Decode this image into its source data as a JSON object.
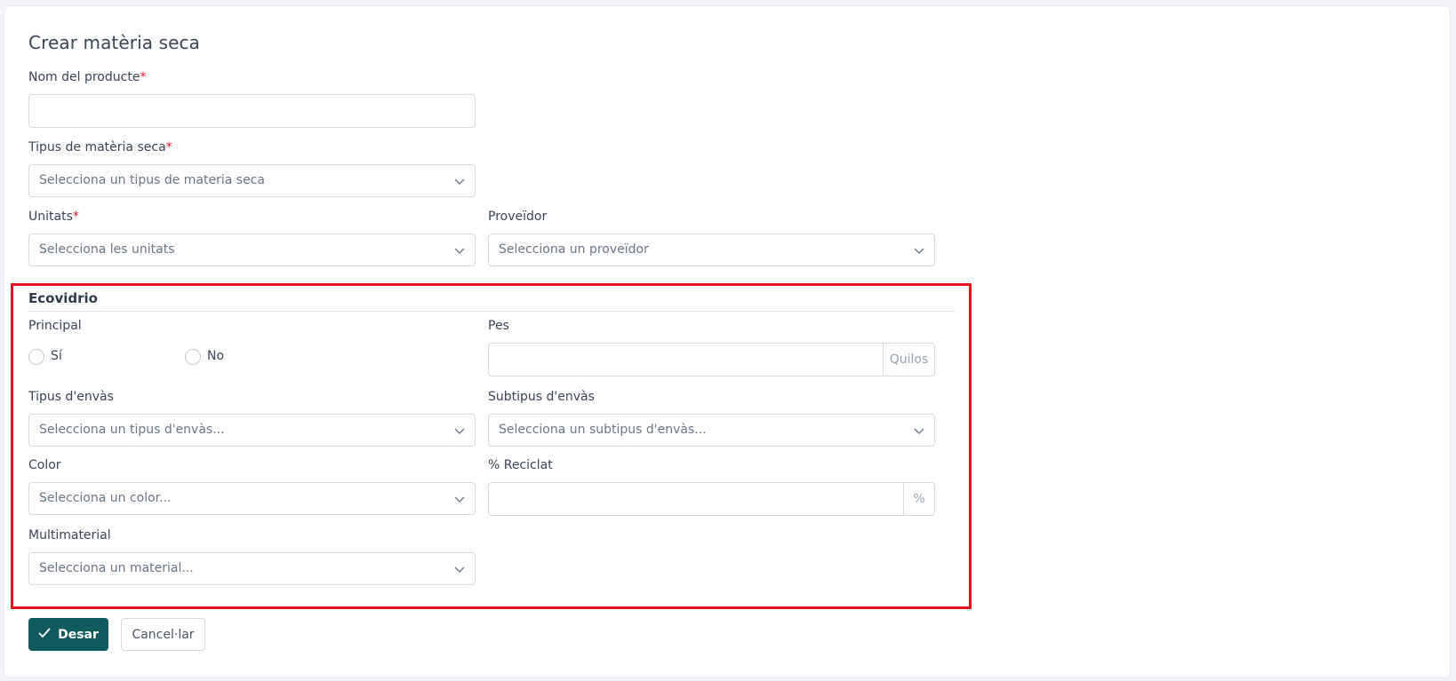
{
  "form": {
    "title": "Crear matèria seca",
    "required_mark": "*",
    "product_name": {
      "label": "Nom del producte",
      "value": ""
    },
    "dry_type": {
      "label": "Tipus de matèria seca",
      "placeholder": "Selecciona un tipus de materia seca"
    },
    "units": {
      "label": "Unitats",
      "placeholder": "Selecciona les unitats"
    },
    "supplier": {
      "label": "Proveïdor",
      "placeholder": "Selecciona un proveïdor"
    }
  },
  "ecovidrio": {
    "title": "Ecovidrio",
    "principal": {
      "label": "Principal",
      "options": [
        "Sí",
        "No"
      ]
    },
    "weight": {
      "label": "Pes",
      "unit": "Quilos",
      "value": ""
    },
    "container_type": {
      "label": "Tipus d'envàs",
      "placeholder": "Selecciona un tipus d'envàs..."
    },
    "container_subtype": {
      "label": "Subtipus d'envàs",
      "placeholder": "Selecciona un subtipus d'envàs..."
    },
    "color": {
      "label": "Color",
      "placeholder": "Selecciona un color..."
    },
    "recycled": {
      "label": "% Reciclat",
      "unit": "%",
      "value": ""
    },
    "multimaterial": {
      "label": "Multimaterial",
      "placeholder": "Selecciona un material..."
    }
  },
  "actions": {
    "save_label": "Desar",
    "cancel_label": "Cancel·lar"
  },
  "colors": {
    "primary": "#0e5a5f",
    "required": "#e11d2e",
    "highlight_border": "#e4131f"
  },
  "icons": {
    "chevron": "chevron-down-icon",
    "check": "check-icon"
  }
}
